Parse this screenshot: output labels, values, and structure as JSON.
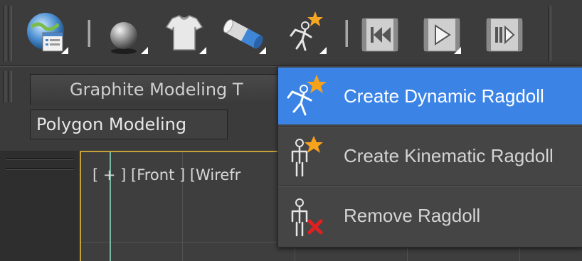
{
  "toolbar": {
    "buttons": [
      {
        "name": "scene-explorer",
        "icon": "globe-window-icon"
      },
      {
        "name": "rigid-body",
        "icon": "sphere-icon"
      },
      {
        "name": "cloth",
        "icon": "tshirt-icon"
      },
      {
        "name": "constraint",
        "icon": "cylinder-icon"
      },
      {
        "name": "ragdoll",
        "icon": "ragdoll-icon"
      },
      {
        "name": "simulation-rewind",
        "icon": "film-rewind-icon"
      },
      {
        "name": "simulation-play",
        "icon": "film-play-icon"
      },
      {
        "name": "simulation-step",
        "icon": "film-step-icon"
      }
    ]
  },
  "ribbon": {
    "tab_title": "Graphite Modeling T",
    "panel_title": "Polygon Modeling"
  },
  "viewport": {
    "label": "[ + ] [Front ] [Wirefr"
  },
  "menu": {
    "items": [
      {
        "label": "Create Dynamic Ragdoll",
        "icon": "dynamic-ragdoll-icon",
        "selected": true
      },
      {
        "label": "Create Kinematic Ragdoll",
        "icon": "kinematic-ragdoll-icon",
        "selected": false
      },
      {
        "label": "Remove Ragdoll",
        "icon": "remove-ragdoll-icon",
        "selected": false
      }
    ]
  },
  "colors": {
    "menu_highlight": "#3b84e6",
    "viewport_border": "#c4a238",
    "axis": "#79b9a3",
    "remove_x": "#e02020"
  }
}
